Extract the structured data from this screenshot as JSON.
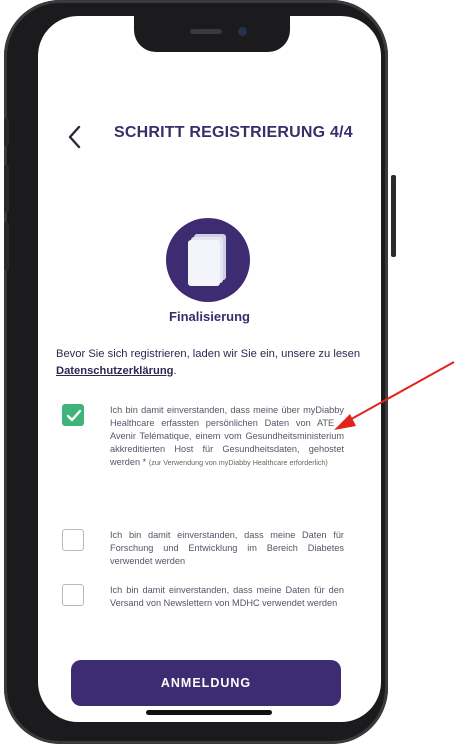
{
  "header": {
    "title": "SCHRITT REGISTRIERUNG 4/4"
  },
  "section": {
    "title": "Finalisierung"
  },
  "intro": {
    "text_before": "Bevor Sie sich registrieren, laden wir Sie ein, unsere zu lesen ",
    "link": "Datenschutzerklärung",
    "text_after": "."
  },
  "consents": [
    {
      "checked": true,
      "text": "Ich bin damit einverstanden, dass meine über myDiabby Healthcare erfassten persönlichen Daten von ATE - Avenir Telématique, einem vom Gesundheitsministerium akkreditierten Host für Gesundheitsdaten, gehostet werden *",
      "note": "(zur Verwendung von myDiabby Healthcare erforderlich)"
    },
    {
      "checked": false,
      "text": "Ich bin damit einverstanden, dass meine Daten für Forschung und Entwicklung im Bereich Diabetes verwendet werden"
    },
    {
      "checked": false,
      "text": "Ich bin damit einverstanden, dass meine Daten für den Versand von Newslettern von MDHC verwendet werden"
    }
  ],
  "submit": {
    "label": "ANMELDUNG"
  },
  "colors": {
    "brand": "#3e2c73",
    "check": "#3fb37a",
    "arrow": "#e3231b"
  },
  "icons": {
    "back": "chevron-left-icon",
    "document": "document-stack-icon",
    "checkmark": "checkmark-icon",
    "annotation": "red-arrow-icon"
  }
}
